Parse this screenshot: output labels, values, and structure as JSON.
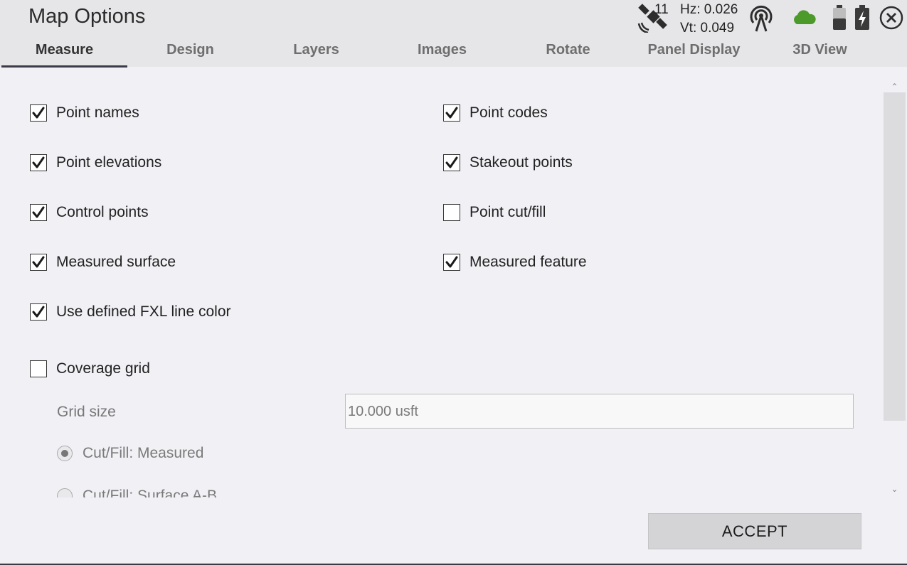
{
  "window": {
    "title": "Map Options"
  },
  "status": {
    "satellites": "11",
    "hz": "Hz: 0.026",
    "vt": "Vt: 0.049",
    "icons": [
      "satellite-icon",
      "radio-signal-icon",
      "cloud-icon",
      "battery-icon",
      "battery-charging-icon",
      "close-icon"
    ],
    "cloud_color": "#4c9a2a"
  },
  "tabs": [
    {
      "label": "Measure",
      "active": true
    },
    {
      "label": "Design"
    },
    {
      "label": "Layers"
    },
    {
      "label": "Images"
    },
    {
      "label": "Rotate"
    },
    {
      "label": "Panel Display"
    },
    {
      "label": "3D View"
    }
  ],
  "options": {
    "point_names": {
      "label": "Point names",
      "checked": true
    },
    "point_codes": {
      "label": "Point codes",
      "checked": true
    },
    "point_elevations": {
      "label": "Point elevations",
      "checked": true
    },
    "stakeout_points": {
      "label": "Stakeout points",
      "checked": true
    },
    "control_points": {
      "label": "Control points",
      "checked": true
    },
    "point_cut_fill": {
      "label": "Point cut/fill",
      "checked": false
    },
    "measured_surface": {
      "label": "Measured surface",
      "checked": true
    },
    "measured_feature": {
      "label": "Measured feature",
      "checked": true
    },
    "fxl_line_color": {
      "label": "Use defined FXL line color",
      "checked": true
    },
    "coverage_grid": {
      "label": "Coverage grid",
      "checked": false
    }
  },
  "grid": {
    "label": "Grid size",
    "value": "10.000 usft",
    "radios": [
      {
        "label": "Cut/Fill: Measured",
        "selected": true
      },
      {
        "label": "Cut/Fill: Surface A-B",
        "selected": false
      }
    ]
  },
  "actions": {
    "accept_label": "ACCEPT"
  }
}
